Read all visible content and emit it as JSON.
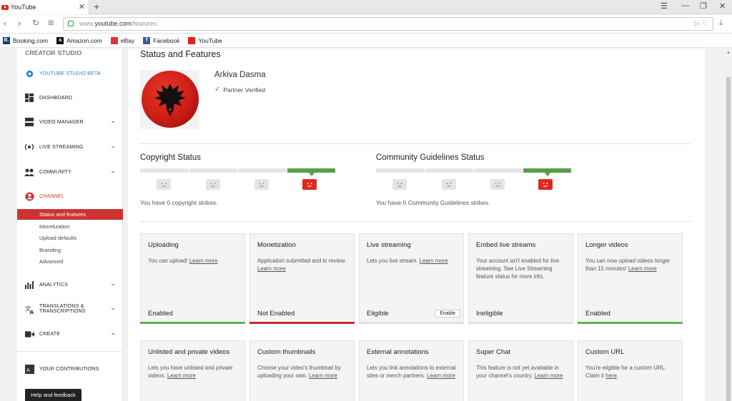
{
  "browser": {
    "tab_title": "YouTube",
    "url_prefix": "www.",
    "url_host": "youtube.com",
    "url_path": "/features",
    "bookmarks": [
      {
        "label": "Booking.com",
        "icon": "booking-icon",
        "color": "#0c3b7c",
        "glyph": "B."
      },
      {
        "label": "Amazon.com",
        "icon": "amazon-icon",
        "color": "#111111",
        "glyph": "a"
      },
      {
        "label": "eBay",
        "icon": "ebay-icon",
        "color": "#e53238",
        "glyph": ""
      },
      {
        "label": "Facebook",
        "icon": "facebook-icon",
        "color": "#3b5998",
        "glyph": "f"
      },
      {
        "label": "YouTube",
        "icon": "youtube-icon",
        "color": "#e62117",
        "glyph": ""
      }
    ]
  },
  "sidebar": {
    "title": "CREATOR STUDIO",
    "items": [
      {
        "label": "YOUTUBE STUDIO BETA",
        "icon": "gear-icon",
        "chevron": false
      },
      {
        "label": "DASHBOARD",
        "icon": "dashboard-icon",
        "chevron": false
      },
      {
        "label": "VIDEO MANAGER",
        "icon": "video-manager-icon",
        "chevron": true
      },
      {
        "label": "LIVE STREAMING",
        "icon": "live-icon",
        "chevron": true
      },
      {
        "label": "COMMUNITY",
        "icon": "community-icon",
        "chevron": true
      },
      {
        "label": "CHANNEL",
        "icon": "channel-icon",
        "chevron": false
      },
      {
        "label": "ANALYTICS",
        "icon": "analytics-icon",
        "chevron": true
      },
      {
        "label": "TRANSLATIONS &",
        "label2": "TRANSCRIPTIONS",
        "icon": "translate-icon",
        "chevron": true
      },
      {
        "label": "CREATE",
        "icon": "create-icon",
        "chevron": true
      },
      {
        "label": "YOUR CONTRIBUTIONS",
        "icon": "contributions-icon",
        "chevron": false
      }
    ],
    "channel_sub": [
      "Status and features",
      "Monetization",
      "Upload defaults",
      "Branding",
      "Advanced"
    ],
    "help_button": "Help and feedback"
  },
  "main": {
    "title": "Status and Features",
    "channel_name": "Arkiva Dasma",
    "verified_label": "Partner Verified",
    "copyright": {
      "title": "Copyright Status",
      "text": "You have 0 copyright strikes."
    },
    "community": {
      "title": "Community Guidelines Status",
      "text": "You have 0 Community Guidelines strikes."
    },
    "colors": {
      "accent": "#cc3333",
      "green": "#56a048",
      "red": "#e0291f"
    },
    "cards": [
      {
        "title": "Uploading",
        "desc": "You can upload!",
        "link": "Learn more",
        "status": "Enabled",
        "bar": "green"
      },
      {
        "title": "Monetization",
        "desc": "Application submitted and in review.",
        "link": "Learn more",
        "status": "Not Enabled",
        "bar": "red"
      },
      {
        "title": "Live streaming",
        "desc": "Lets you live stream.",
        "link": "Learn more",
        "status": "Eligible",
        "bar": "gray",
        "button": "Enable"
      },
      {
        "title": "Embed live streams",
        "desc": "Your account isn't enabled for live streaming. See Live Streaming feature status for more info.",
        "link": "",
        "status": "Ineligible",
        "bar": "gray"
      },
      {
        "title": "Longer videos",
        "desc": "You can now upload videos longer than 15 minutes!",
        "link": "Learn more",
        "status": "Enabled",
        "bar": "green"
      },
      {
        "title": "Unlisted and private videos",
        "desc": "Lets you have unlisted and private videos.",
        "link": "Learn more",
        "status": "",
        "bar": "none"
      },
      {
        "title": "Custom thumbnails",
        "desc": "Choose your video's thumbnail by uploading your own.",
        "link": "Learn more",
        "status": "",
        "bar": "none"
      },
      {
        "title": "External annotations",
        "desc": "Lets you link annotations to external sites or merch partners.",
        "link": "Learn more",
        "status": "",
        "bar": "none"
      },
      {
        "title": "Super Chat",
        "desc": "This feature is not yet available in your channel's country.",
        "link": "Learn more",
        "status": "",
        "bar": "none"
      },
      {
        "title": "Custom URL",
        "desc": "You're eligible for a custom URL. Claim it",
        "link": "here",
        "status": "",
        "bar": "none",
        "suffix": "."
      }
    ]
  }
}
